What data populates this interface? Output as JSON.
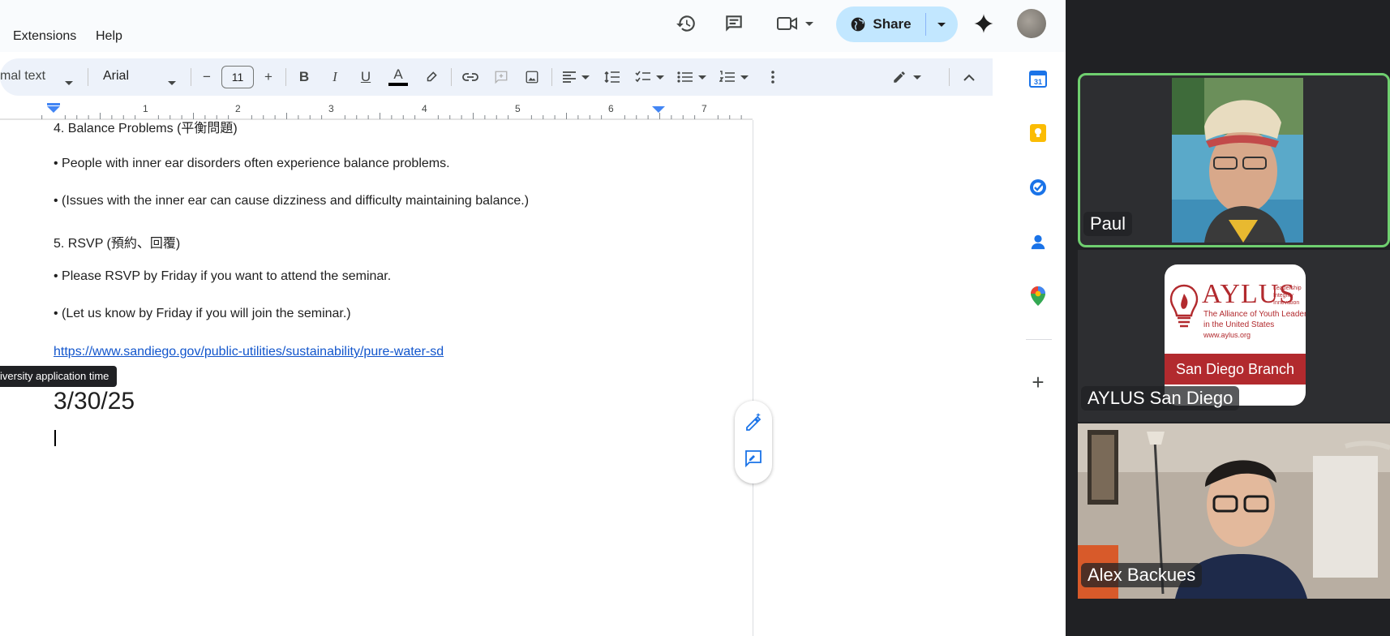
{
  "menu": {
    "extensions": "Extensions",
    "help": "Help"
  },
  "share": {
    "label": "Share"
  },
  "toolbar": {
    "style": "mal text",
    "font": "Arial",
    "font_size": "11",
    "minus": "−",
    "plus": "+",
    "bold": "B",
    "italic": "I",
    "underline": "U",
    "text_color": "A"
  },
  "ruler": {
    "marks": [
      "1",
      "2",
      "3",
      "4",
      "5",
      "6",
      "7"
    ]
  },
  "doc": {
    "lines": [
      "4. Balance Problems (平衡問題)",
      "• People with inner ear disorders often experience balance problems.",
      "• (Issues with the inner ear can cause dizziness and difficulty maintaining balance.)",
      "5. RSVP (預約、回覆)",
      "• Please RSVP by Friday if you want to attend the seminar.",
      "• (Let us know by Friday if you will join the seminar.)"
    ],
    "link": "https://www.sandiego.gov/public-utilities/sustainability/pure-water-sd",
    "date": "3/30/25"
  },
  "tooltip": {
    "text": "iversity application time"
  },
  "side_panel": {
    "calendar_day": "31",
    "add": "+"
  },
  "meet": {
    "participants": [
      {
        "name": "Paul"
      },
      {
        "name": "AYLUS San Diego"
      },
      {
        "name": "Alex Backues"
      }
    ],
    "aylus_logo": {
      "title": "AYLUS",
      "motto": [
        "Leadership",
        "Integrity",
        "Innovation"
      ],
      "subtitle_1": "The Alliance of Youth Leaders",
      "subtitle_2": "in the United States",
      "url": "www.aylus.org",
      "branch": "San Diego Branch"
    }
  },
  "colors": {
    "accent": "#1a73e8",
    "share_bg": "#c2e7ff",
    "toolbar_bg": "#edf2fa",
    "active_speaker": "#6fcf6f",
    "meet_bg": "#202124",
    "aylus_red": "#b22a2e"
  }
}
